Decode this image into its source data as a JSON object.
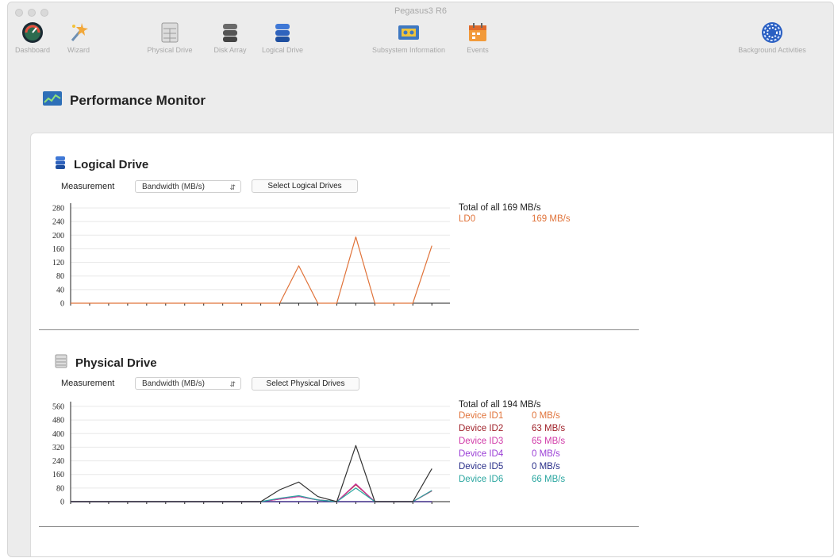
{
  "window": {
    "title": "Pegasus3 R6"
  },
  "toolbar": {
    "dashboard": "Dashboard",
    "wizard": "Wizard",
    "physical_drive": "Physical Drive",
    "disk_array": "Disk Array",
    "logical_drive": "Logical Drive",
    "subsystem_information": "Subsystem Information",
    "events": "Events",
    "background_activities": "Background Activities"
  },
  "page": {
    "title": "Performance Monitor"
  },
  "logical_section": {
    "title": "Logical Drive",
    "measurement_label": "Measurement",
    "measurement_value": "Bandwidth (MB/s)",
    "select_button": "Select Logical Drives",
    "total_label": "Total of all 169 MB/s",
    "legend": [
      {
        "name": "LD0",
        "value": "169 MB/s",
        "color": "#e0733a"
      }
    ]
  },
  "physical_section": {
    "title": "Physical Drive",
    "measurement_label": "Measurement",
    "measurement_value": "Bandwidth (MB/s)",
    "select_button": "Select Physical Drives",
    "total_label": "Total of all 194 MB/s",
    "legend": [
      {
        "name": "Device ID1",
        "value": "0 MB/s",
        "color": "#e0733a"
      },
      {
        "name": "Device ID2",
        "value": "63 MB/s",
        "color": "#a0222a"
      },
      {
        "name": "Device ID3",
        "value": "65 MB/s",
        "color": "#d13aa8"
      },
      {
        "name": "Device ID4",
        "value": "0 MB/s",
        "color": "#9b3fd6"
      },
      {
        "name": "Device ID5",
        "value": "0 MB/s",
        "color": "#2a2f8a"
      },
      {
        "name": "Device ID6",
        "value": "66 MB/s",
        "color": "#2aa6a0"
      }
    ]
  },
  "chart_data": [
    {
      "type": "line",
      "title": "Logical Drive",
      "ylim": [
        0,
        280
      ],
      "yticks": [
        0,
        40,
        80,
        120,
        160,
        200,
        240,
        280
      ],
      "x": [
        0,
        1,
        2,
        3,
        4,
        5,
        6,
        7,
        8,
        9,
        10,
        11,
        12,
        13,
        14,
        15,
        16,
        17,
        18,
        19
      ],
      "series": [
        {
          "name": "LD0",
          "color": "#e0733a",
          "values": [
            0,
            0,
            0,
            0,
            0,
            0,
            0,
            0,
            0,
            0,
            0,
            0,
            110,
            0,
            0,
            195,
            0,
            0,
            0,
            169
          ]
        }
      ]
    },
    {
      "type": "line",
      "title": "Physical Drive",
      "ylim": [
        0,
        560
      ],
      "yticks": [
        0,
        80,
        160,
        240,
        320,
        400,
        480,
        560
      ],
      "x": [
        0,
        1,
        2,
        3,
        4,
        5,
        6,
        7,
        8,
        9,
        10,
        11,
        12,
        13,
        14,
        15,
        16,
        17,
        18,
        19
      ],
      "series": [
        {
          "name": "Device ID1",
          "color": "#e0733a",
          "values": [
            0,
            0,
            0,
            0,
            0,
            0,
            0,
            0,
            0,
            0,
            0,
            0,
            0,
            0,
            0,
            0,
            0,
            0,
            0,
            0
          ]
        },
        {
          "name": "Device ID2",
          "color": "#a0222a",
          "values": [
            0,
            0,
            0,
            0,
            0,
            0,
            0,
            0,
            0,
            0,
            0,
            15,
            30,
            10,
            0,
            100,
            0,
            0,
            0,
            63
          ]
        },
        {
          "name": "Device ID3",
          "color": "#d13aa8",
          "values": [
            0,
            0,
            0,
            0,
            0,
            0,
            0,
            0,
            0,
            0,
            0,
            15,
            30,
            10,
            0,
            105,
            0,
            0,
            0,
            65
          ]
        },
        {
          "name": "Device ID4",
          "color": "#9b3fd6",
          "values": [
            0,
            0,
            0,
            0,
            0,
            0,
            0,
            0,
            0,
            0,
            0,
            0,
            0,
            0,
            0,
            0,
            0,
            0,
            0,
            0
          ]
        },
        {
          "name": "Device ID5",
          "color": "#2a2f8a",
          "values": [
            0,
            0,
            0,
            0,
            0,
            0,
            0,
            0,
            0,
            0,
            0,
            0,
            0,
            0,
            0,
            0,
            0,
            0,
            0,
            0
          ]
        },
        {
          "name": "Device ID6",
          "color": "#2aa6a0",
          "values": [
            0,
            0,
            0,
            0,
            0,
            0,
            0,
            0,
            0,
            0,
            0,
            20,
            35,
            10,
            0,
            80,
            0,
            0,
            0,
            66
          ]
        },
        {
          "name": "",
          "color": "#333333",
          "values": [
            0,
            0,
            0,
            0,
            0,
            0,
            0,
            0,
            0,
            0,
            0,
            70,
            115,
            30,
            0,
            330,
            0,
            0,
            0,
            194
          ]
        }
      ]
    }
  ]
}
